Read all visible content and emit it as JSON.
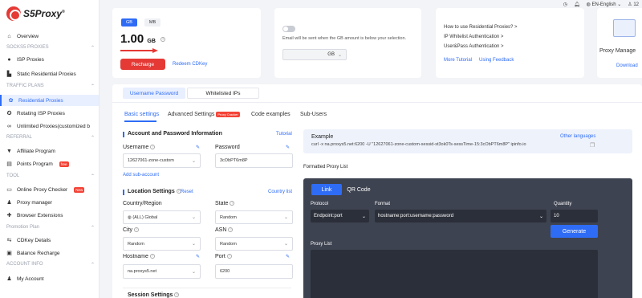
{
  "brand": {
    "name": "S5Proxy",
    "reg": "®"
  },
  "topbar": {
    "language": "EN-English",
    "user": "12"
  },
  "sidebar": {
    "overview": "Overview",
    "sections": {
      "socks5": "SOCKS5 PROXIES",
      "traffic": "TRAFFIC PLANS",
      "referral": "REFERRAL",
      "tool": "TOOL",
      "promotion": "Promotion Plan",
      "account": "ACCOUNT INFO"
    },
    "items": {
      "isp": "ISP Proxies",
      "static_res": "Static Residential Proxies",
      "residential": "Residential Proxies",
      "rotating_isp": "Rotating ISP Proxies",
      "unlimited": "Unlimited Proxies(customized b",
      "affiliate": "Affiliate Program",
      "points": "Points Program",
      "points_badge": "free",
      "checker": "Online Proxy Checker",
      "checker_badge": "New",
      "manager": "Proxy manager",
      "extensions": "Browser Extensions",
      "cdkey": "CDKey Details",
      "balance": "Balance Recharge",
      "my_account": "My Account"
    }
  },
  "balance": {
    "tab_gb": "GB",
    "tab_mb": "MB",
    "amount": "1.00",
    "unit": "GB",
    "recharge": "Recharge",
    "redeem": "Redeem CDKey"
  },
  "alert": {
    "text": "Email will be sent when the GB amount is below your selection.",
    "select_unit": "GB"
  },
  "help": {
    "links": [
      "How to use Residential Proxies? >",
      "IP Whitelist Authentication >",
      "User&Pass Authentication >"
    ],
    "more": "More Tutorial",
    "feedback": "Using Feedback"
  },
  "manager_card": {
    "title": "Proxy Manage",
    "download": "Download"
  },
  "auth_tabs": {
    "userpass": "Username Password",
    "whitelist": "Whitelisted IPs"
  },
  "sub_tabs": {
    "basic": "Basic settings",
    "advanced": "Advanced Settings",
    "advanced_badge": "Proxy Cracker",
    "code": "Code examples",
    "subusers": "Sub-Users"
  },
  "account_info": {
    "title": "Account and Password Information",
    "tutorial": "Tutorial",
    "username_label": "Username",
    "username_value": "12627061-zone-custom",
    "password_label": "Password",
    "password_value": "3cObPT6m8P",
    "add_sub": "Add sub-account"
  },
  "location": {
    "title": "Location Settings",
    "reset": "Reset",
    "country_list": "Country list",
    "country_label": "Country/Region",
    "country_value": "(ALL) Global",
    "state_label": "State",
    "state_value": "Random",
    "city_label": "City",
    "city_value": "Random",
    "asn_label": "ASN",
    "asn_value": "Random",
    "hostname_label": "Hostname",
    "hostname_value": "na.proxys5.net",
    "port_label": "Port",
    "port_value": "6200",
    "session_title": "Session Settings"
  },
  "example": {
    "title": "Example",
    "command": "curl -x na.proxys5.net:6200 -U \"12627061-zone-custom-sessid-st3ok0Ts-sessTime-15:3cObPT6m8P\" ipinfo.io",
    "other_lang": "Other languages"
  },
  "formatted": {
    "title": "Formatted Proxy List",
    "tab_link": "Link",
    "tab_qr": "QR Code",
    "protocol_label": "Protocol",
    "protocol_value": "Endpoint:port",
    "format_label": "Format",
    "format_value": "hostname:port:username:password",
    "quantity_label": "Quantity",
    "quantity_value": "10",
    "generate": "Generate",
    "list_label": "Proxy List"
  }
}
